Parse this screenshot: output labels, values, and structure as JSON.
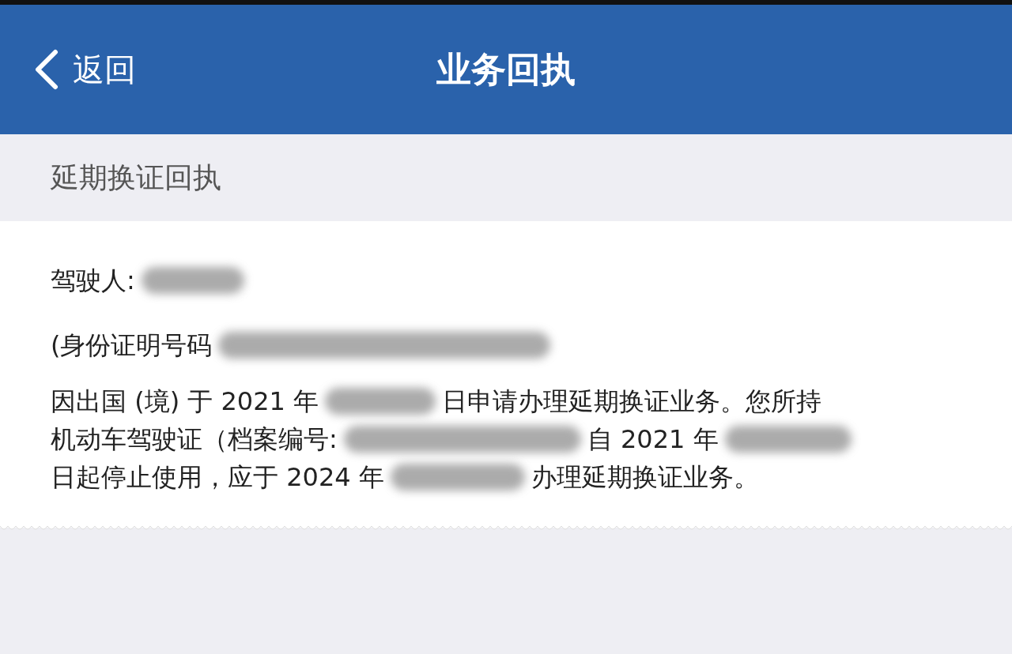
{
  "header": {
    "back_label": "返回",
    "title": "业务回执"
  },
  "section_title": "延期换证回执",
  "receipt_lines": [
    [
      {
        "kind": "text",
        "text": "驾驶人:"
      },
      {
        "kind": "redacted"
      }
    ],
    [
      {
        "kind": "text",
        "text": "(身份证明号码"
      },
      {
        "kind": "redacted"
      }
    ],
    [
      {
        "kind": "text",
        "text": "因出国 (境) 于 2021 年"
      },
      {
        "kind": "redacted"
      },
      {
        "kind": "text",
        "text": "日申请办理延期换证业务。您所持"
      }
    ],
    [
      {
        "kind": "text",
        "text": "机动车驾驶证（档案编号:"
      },
      {
        "kind": "redacted"
      },
      {
        "kind": "text",
        "text": "自 2021 年"
      },
      {
        "kind": "redacted"
      }
    ],
    [
      {
        "kind": "text",
        "text": "日起停止使用，应于 2024 年"
      },
      {
        "kind": "redacted"
      },
      {
        "kind": "text",
        "text": "办理延期换证业务。"
      }
    ]
  ]
}
